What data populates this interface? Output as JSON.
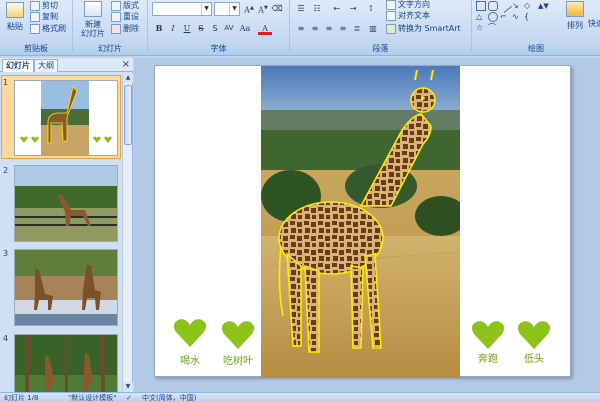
{
  "ribbon": {
    "clipboard": {
      "paste": "粘贴",
      "cut": "剪切",
      "copy": "复制",
      "format_painter": "格式刷",
      "label": "剪贴板"
    },
    "slides": {
      "new_slide": "新建\n幻灯片",
      "layout": "版式",
      "reset": "重设",
      "delete": "删除",
      "label": "幻灯片"
    },
    "font": {
      "label": "字体",
      "bold": "B",
      "italic": "I",
      "underline": "U",
      "strike": "S",
      "aa": "A",
      "aa_small": "A",
      "label_aa": "Aa",
      "font_color": "A"
    },
    "paragraph": {
      "label": "段落",
      "text_direction": "文字方向",
      "align_text": "对齐文本",
      "smartart": "转换为 SmartArt"
    },
    "drawing": {
      "label": "绘图",
      "arrange": "排列",
      "quick": "快速"
    }
  },
  "panel": {
    "tab_slides": "幻灯片",
    "tab_outline": "大纲",
    "close": "×",
    "thumbs": [
      {
        "num": "1"
      },
      {
        "num": "2"
      },
      {
        "num": "3"
      },
      {
        "num": "4"
      }
    ]
  },
  "slide": {
    "left_hearts": [
      "喝水",
      "吃树叶"
    ],
    "right_hearts": [
      "奔跑",
      "低头"
    ],
    "heart_color": "#8cc21a",
    "outline_color": "#ffea00"
  },
  "status": {
    "slide_count": "幻灯片 1/8",
    "theme": "\"默认设计模板\"",
    "language": "中文(简体，中国)"
  }
}
